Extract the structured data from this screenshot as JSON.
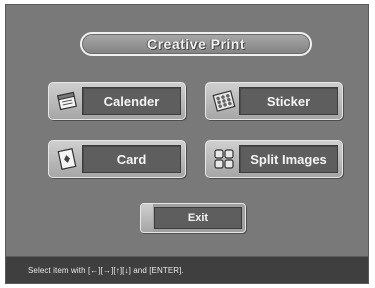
{
  "header": {
    "title": "Creative Print"
  },
  "menu": {
    "calender": {
      "label": "Calender",
      "icon": "calendar-icon"
    },
    "sticker": {
      "label": "Sticker",
      "icon": "sticker-sheet-icon"
    },
    "card": {
      "label": "Card",
      "icon": "card-icon"
    },
    "split": {
      "label": "Split Images",
      "icon": "split-images-icon"
    }
  },
  "exit": {
    "label": "Exit"
  },
  "status": {
    "text": "Select item with [←][→][↑][↓] and [ENTER]."
  },
  "colors": {
    "background": "#797979",
    "button_face": "#b8b8b8",
    "label_box": "#5e5e5e",
    "status_bar": "#3f3f3f"
  }
}
